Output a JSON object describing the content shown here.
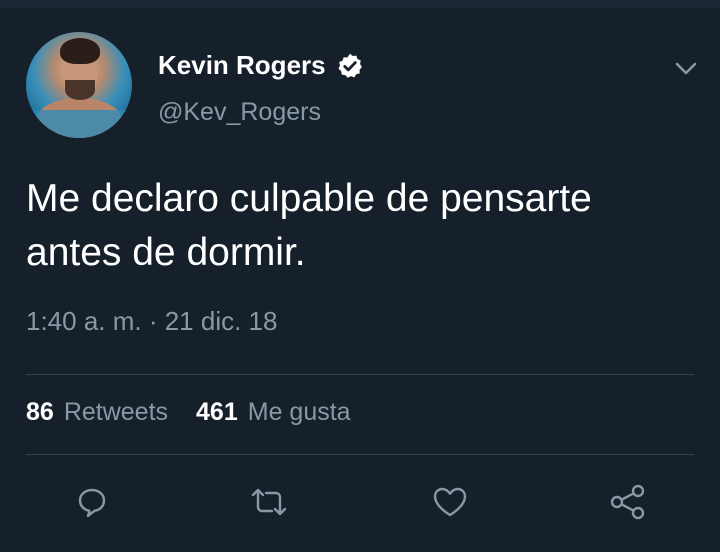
{
  "tweet": {
    "author_name": "Kevin Rogers",
    "handle": "@Kev_Rogers",
    "text_line1": "Me declaro culpable de pensarte",
    "text_line2": "antes de dormir.",
    "timestamp": "1:40 a. m. · 21 dic. 18",
    "retweets_count": "86",
    "retweets_label": "Retweets",
    "likes_count": "461",
    "likes_label": "Me gusta"
  },
  "icons": {
    "verified": "verified-badge-icon",
    "menu": "chevron-down-icon",
    "reply": "reply-icon",
    "retweet": "retweet-icon",
    "like": "heart-icon",
    "share": "share-icon"
  },
  "colors": {
    "background": "#15202b",
    "primary_text": "#ffffff",
    "secondary_text": "#8899a6",
    "divider": "#38444d"
  }
}
